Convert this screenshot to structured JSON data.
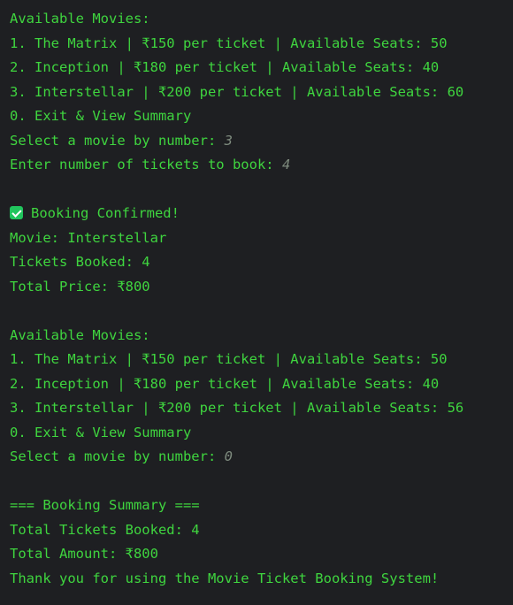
{
  "console": {
    "menu1": {
      "header": "Available Movies:",
      "items": [
        "1. The Matrix | ₹150 per ticket | Available Seats: 50",
        "2. Inception | ₹180 per ticket | Available Seats: 40",
        "3. Interstellar | ₹200 per ticket | Available Seats: 60",
        "0. Exit & View Summary"
      ],
      "select_prompt": "Select a movie by number: ",
      "select_input": "3",
      "tickets_prompt": "Enter number of tickets to book: ",
      "tickets_input": "4"
    },
    "confirmation": {
      "icon": "check-box-icon",
      "title": "Booking Confirmed!",
      "movie": "Movie: Interstellar",
      "tickets": "Tickets Booked: 4",
      "total": "Total Price: ₹800"
    },
    "menu2": {
      "header": "Available Movies:",
      "items": [
        "1. The Matrix | ₹150 per ticket | Available Seats: 50",
        "2. Inception | ₹180 per ticket | Available Seats: 40",
        "3. Interstellar | ₹200 per ticket | Available Seats: 56",
        "0. Exit & View Summary"
      ],
      "select_prompt": "Select a movie by number: ",
      "select_input": "0"
    },
    "summary": {
      "title": "=== Booking Summary ===",
      "total_tickets": "Total Tickets Booked: 4",
      "total_amount": "Total Amount: ₹800",
      "thanks": "Thank you for using the Movie Ticket Booking System!"
    }
  },
  "colors": {
    "background": "#1e1f22",
    "output_text": "#3fd53f",
    "user_input": "#7d8a7d",
    "check_icon": "#21c55d"
  }
}
